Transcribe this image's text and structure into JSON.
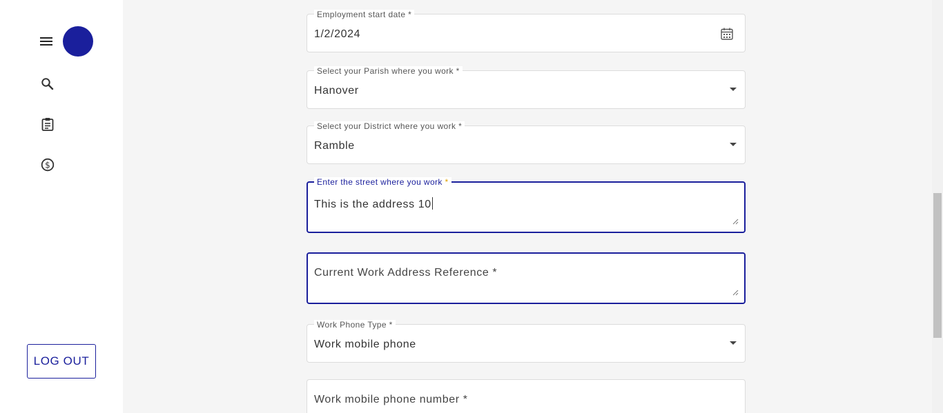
{
  "sidebar": {
    "menu_icon": "menu-icon",
    "nav": [
      {
        "icon": "search-icon"
      },
      {
        "icon": "clipboard-icon"
      },
      {
        "icon": "dollar-icon"
      }
    ],
    "logout_label": "LOG OUT"
  },
  "form": {
    "employment_start": {
      "label": "Employment start date *",
      "value": "1/2/2024"
    },
    "parish": {
      "label": "Select your Parish where you work *",
      "value": "Hanover"
    },
    "district": {
      "label": "Select your District where you work *",
      "value": "Ramble"
    },
    "street": {
      "label": "Enter the street where you work",
      "required_mark": "*",
      "value": "This is the address 10"
    },
    "work_address_reference": {
      "placeholder": "Current Work Address Reference *"
    },
    "phone_type": {
      "label": "Work Phone Type *",
      "value": "Work mobile phone"
    },
    "phone_number": {
      "placeholder": "Work mobile phone number *"
    }
  },
  "colors": {
    "accent": "#1a1f9c",
    "required": "#e0a000"
  }
}
